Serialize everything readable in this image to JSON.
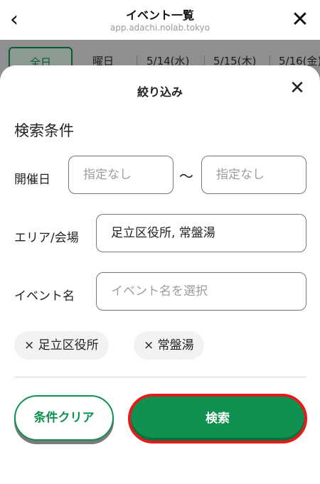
{
  "browser": {
    "title": "イベント一覧",
    "url": "app.adachi.nolab.tokyo",
    "back_icon": "‹",
    "close_icon": "✕"
  },
  "tabs": [
    "全日",
    "曜日",
    "5/14(水)",
    "5/15(木)",
    "5/16(金)"
  ],
  "sheet": {
    "title": "絞り込み",
    "close_icon": "✕",
    "section_title": "検索条件",
    "date": {
      "label": "開催日",
      "from_placeholder": "指定なし",
      "separator": "〜",
      "to_placeholder": "指定なし"
    },
    "area": {
      "label": "エリア/会場",
      "value": "足立区役所, 常盤湯"
    },
    "event": {
      "label": "イベント名",
      "placeholder": "イベント名を選択"
    },
    "chips": [
      "× 足立区役所",
      "× 常盤湯"
    ],
    "buttons": {
      "clear": "条件クリア",
      "search": "検索"
    }
  },
  "colors": {
    "accent": "#0e9150",
    "highlight": "#e41b1b",
    "backdrop": "#8a8a8a"
  }
}
